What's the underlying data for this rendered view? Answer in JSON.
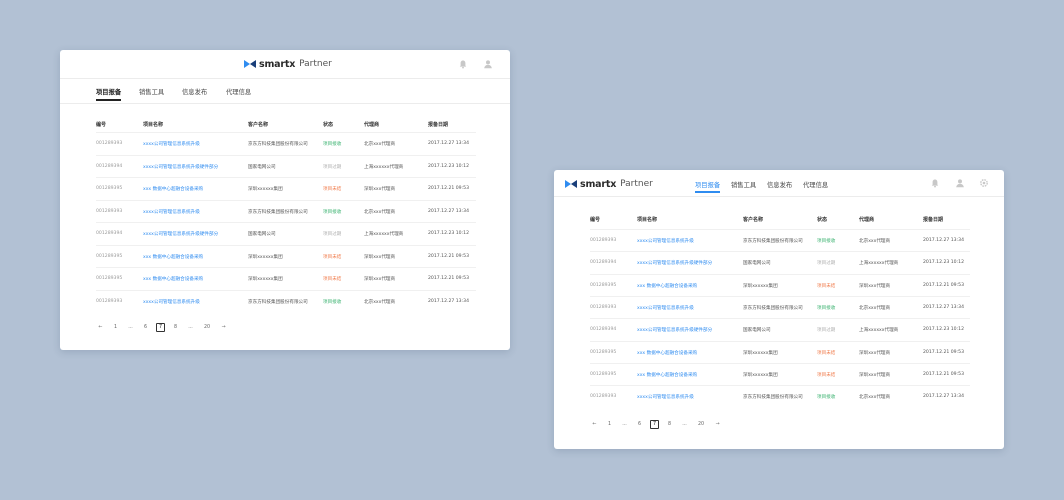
{
  "brand": {
    "name": "smartx",
    "suffix": "Partner"
  },
  "colors": {
    "link": "#2f8cf0",
    "status_green": "#3cb371",
    "status_gray": "#b0b0b0",
    "status_orange": "#f07c4c"
  },
  "header_icons": [
    "bell-icon",
    "user-icon",
    "settings-icon"
  ],
  "nav": {
    "tabs": [
      "项目报备",
      "销售工具",
      "信息发布",
      "代理信息"
    ],
    "active": "项目报备"
  },
  "table": {
    "headers": [
      "编号",
      "项目名称",
      "客户名称",
      "状态",
      "代理商",
      "报备日期"
    ],
    "rows": [
      {
        "code": "001289393",
        "name": "xxxx公司管理信息系统升级",
        "customer": "京东方科技集团股份有限公司",
        "status": "项目接收",
        "status_color": "green",
        "agent": "北京xxx代理商",
        "date": "2017.12.27  13:34"
      },
      {
        "code": "001289394",
        "name": "xxxx公司管理信息系统升级硬件部分",
        "customer": "国家电网公司",
        "status": "项目过期",
        "status_color": "gray",
        "agent": "上海xxxxxx代理商",
        "date": "2017.12.23  10:12"
      },
      {
        "code": "001289395",
        "name": "xxx 数据中心超融合设备采购",
        "customer": "深圳xxxxxx集团",
        "status": "项目未结",
        "status_color": "orange",
        "agent": "深圳xxx代理商",
        "date": "2017.12.21  09:53"
      },
      {
        "code": "001289393",
        "name": "xxxx公司管理信息系统升级",
        "customer": "京东方科技集团股份有限公司",
        "status": "项目接收",
        "status_color": "green",
        "agent": "北京xxx代理商",
        "date": "2017.12.27  13:34"
      },
      {
        "code": "001289394",
        "name": "xxxx公司管理信息系统升级硬件部分",
        "customer": "国家电网公司",
        "status": "项目过期",
        "status_color": "gray",
        "agent": "上海xxxxxx代理商",
        "date": "2017.12.23  10:12"
      },
      {
        "code": "001289395",
        "name": "xxx 数据中心超融合设备采购",
        "customer": "深圳xxxxxx集团",
        "status": "项目未结",
        "status_color": "orange",
        "agent": "深圳xxx代理商",
        "date": "2017.12.21  09:53"
      },
      {
        "code": "001289395",
        "name": "xxx 数据中心超融合设备采购",
        "customer": "深圳xxxxxx集团",
        "status": "项目未结",
        "status_color": "orange",
        "agent": "深圳xxx代理商",
        "date": "2017.12.21  09:53"
      },
      {
        "code": "001289393",
        "name": "xxxx公司管理信息系统升级",
        "customer": "京东方科技集团股份有限公司",
        "status": "项目接收",
        "status_color": "green",
        "agent": "北京xxx代理商",
        "date": "2017.12.27  13:34"
      }
    ]
  },
  "pagination": {
    "prev": "←",
    "next": "→",
    "items": [
      "1",
      "...",
      "6",
      "7",
      "8",
      "...",
      "20"
    ],
    "current": "7"
  }
}
